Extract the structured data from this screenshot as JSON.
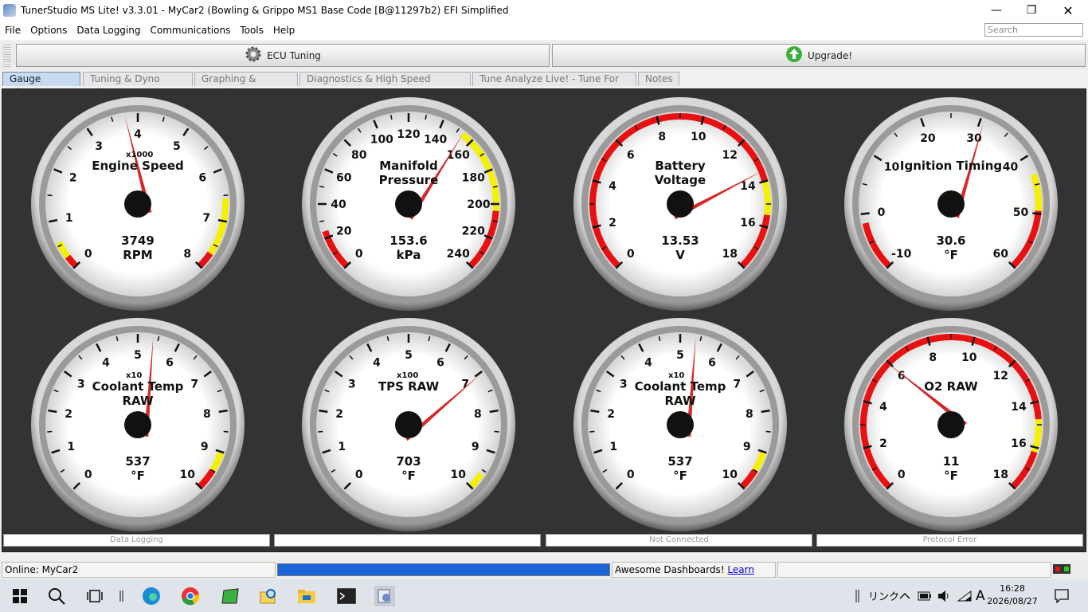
{
  "window": {
    "title": "TunerStudio MS Lite! v3.3.01 - MyCar2 (Bowling & Grippo MS1 Base Code [B@11297b2) EFI Simplified"
  },
  "menu": [
    "File",
    "Options",
    "Data Logging",
    "Communications",
    "Tools",
    "Help"
  ],
  "search": {
    "placeholder": "Search"
  },
  "toolbar": {
    "ecu_tuning": "ECU Tuning",
    "upgrade": "Upgrade!"
  },
  "tabs": [
    "Gauge Cluster",
    "Tuning & Dyno Views",
    "Graphing & Logging",
    "Diagnostics & High Speed Loggers",
    "Tune Analyze Live! - Tune For You",
    "Notes"
  ],
  "gauges": [
    {
      "title": "Engine Speed",
      "mult": "x1000",
      "value": "3749",
      "unit": "RPM",
      "ticks": [
        "0",
        "1",
        "2",
        "3",
        "4",
        "5",
        "6",
        "7",
        "8"
      ],
      "needle_frac": 0.469
    },
    {
      "title": "Manifold Pressure",
      "mult": "",
      "value": "153.6",
      "unit": "kPa",
      "ticks": [
        "0",
        "20",
        "40",
        "60",
        "80",
        "100",
        "120",
        "140",
        "160",
        "180",
        "200",
        "220",
        "240"
      ],
      "needle_frac": 0.64
    },
    {
      "title": "Battery Voltage",
      "mult": "",
      "value": "13.53",
      "unit": "V",
      "ticks": [
        "0",
        "2",
        "4",
        "6",
        "8",
        "10",
        "12",
        "14",
        "16",
        "18"
      ],
      "needle_frac": 0.752
    },
    {
      "title": "Ignition Timing",
      "mult": "",
      "value": "30.6",
      "unit": "°F",
      "ticks": [
        "-10",
        "0",
        "10",
        "20",
        "30",
        "40",
        "50",
        "60"
      ],
      "needle_frac": 0.58
    },
    {
      "title": "Coolant Temp RAW",
      "mult": "x10",
      "value": "537",
      "unit": "°F",
      "ticks": [
        "0",
        "1",
        "2",
        "3",
        "4",
        "5",
        "6",
        "7",
        "8",
        "9",
        "10"
      ],
      "needle_frac": 0.537
    },
    {
      "title": "TPS RAW",
      "mult": "x100",
      "value": "703",
      "unit": "°F",
      "ticks": [
        "0",
        "1",
        "2",
        "3",
        "4",
        "5",
        "6",
        "7",
        "8",
        "9",
        "10"
      ],
      "needle_frac": 0.703
    },
    {
      "title": "Coolant Temp RAW",
      "mult": "x10",
      "value": "537",
      "unit": "°F",
      "ticks": [
        "0",
        "1",
        "2",
        "3",
        "4",
        "5",
        "6",
        "7",
        "8",
        "9",
        "10"
      ],
      "needle_frac": 0.537
    },
    {
      "title": "O2 RAW",
      "mult": "",
      "value": "11",
      "unit": "°F",
      "ticks": [
        "0",
        "2",
        "4",
        "6",
        "8",
        "10",
        "12",
        "14",
        "16",
        "18"
      ],
      "needle_frac": 0.33
    }
  ],
  "status_strips": [
    "Data Logging",
    "",
    "Not Connected",
    "Protocol Error"
  ],
  "statusbar": {
    "online": "Online: MyCar2",
    "progress": 1.0,
    "promo": "Awesome Dashboards!",
    "promo_link": "Learn More!"
  },
  "taskbar": {
    "tray_text": "リンク",
    "time": "16:28",
    "date": "2026/08/27",
    "ime": "A"
  }
}
